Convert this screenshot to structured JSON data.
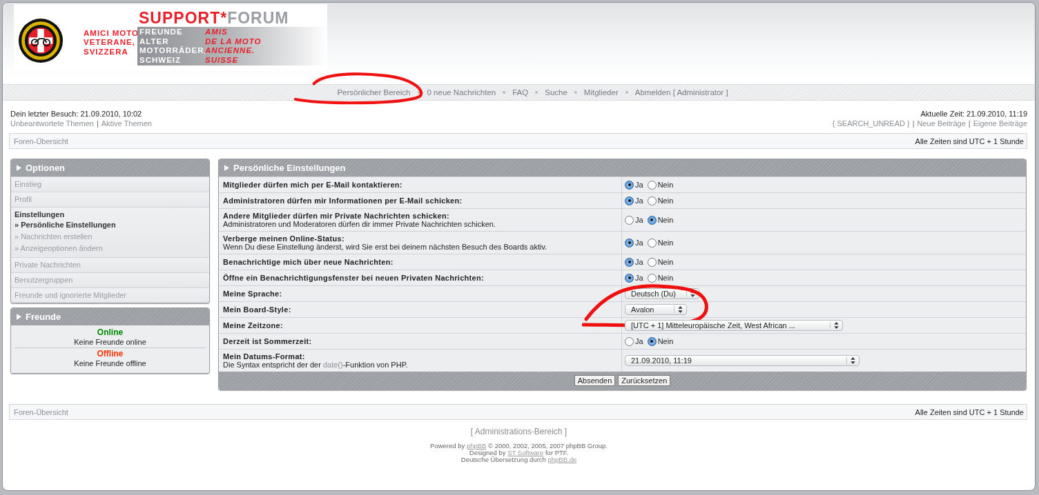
{
  "banner": {
    "title_main": "SUPPORT*",
    "title_tail": "FORUM",
    "italian": [
      "AMICI MOTO",
      "VETERANE,",
      "SVIZZERA"
    ],
    "german": [
      "FREUNDE",
      "ALTER",
      "MOTORRÄDER,",
      "SCHWEIZ"
    ],
    "french": [
      "AMIS",
      "DE LA MOTO",
      "ANCIENNE.",
      "SUISSE"
    ]
  },
  "nav": [
    "Persönlicher Bereich",
    "0 neue Nachrichten",
    "FAQ",
    "Suche",
    "Mitglieder",
    "Abmelden [ Administrator ]"
  ],
  "last_visit": "Dein letzter Besuch: 21.09.2010, 10:02",
  "left_links": [
    {
      "kind": "link",
      "text": "Unbeantwortete Themen"
    },
    {
      "kind": "separator",
      "text": "|"
    },
    {
      "kind": "link",
      "text": "Aktive Themen"
    }
  ],
  "current_time": "Aktuelle Zeit: 21.09.2010, 11:19",
  "right_links": [
    {
      "kind": "link",
      "text": "{ SEARCH_UNREAD }"
    },
    {
      "kind": "separator",
      "text": "|"
    },
    {
      "kind": "link",
      "text": "Neue Beiträge"
    },
    {
      "kind": "separator",
      "text": "|"
    },
    {
      "kind": "link",
      "text": "Eigene Beiträge"
    }
  ],
  "breadcrumb": {
    "link": "Foren-Übersicht",
    "timezone": "Alle Zeiten sind UTC + 1 Stunde"
  },
  "options_panel": {
    "title": "Optionen",
    "items": [
      {
        "label": "Einstieg",
        "selected": false
      },
      {
        "label": "Profil",
        "selected": false
      },
      {
        "label": "Einstellungen",
        "selected": true,
        "children": [
          {
            "label": "» Persönliche Einstellungen",
            "selected": true
          },
          {
            "label": "» Nachrichten erstellen",
            "selected": false
          },
          {
            "label": "» Anzeigeoptionen ändern",
            "selected": false
          }
        ]
      },
      {
        "label": "Private Nachrichten",
        "selected": false
      },
      {
        "label": "Benutzergruppen",
        "selected": false
      },
      {
        "label": "Freunde und ignorierte Mitglieder",
        "selected": false
      }
    ]
  },
  "friends_panel": {
    "title": "Freunde",
    "groups": [
      {
        "status": "Online",
        "color": "#008a00",
        "text": "Keine Freunde online"
      },
      {
        "status": "Offline",
        "color": "#ff3300",
        "text": "Keine Freunde offline"
      }
    ]
  },
  "settings": {
    "title": "Persönliche Einstellungen",
    "rows": [
      {
        "kind": "radio",
        "label": "Mitglieder dürfen mich per E-Mail kontaktieren:",
        "options": [
          {
            "label": "Ja",
            "selected": true
          },
          {
            "label": "Nein",
            "selected": false
          }
        ]
      },
      {
        "kind": "radio",
        "label": "Administratoren dürfen mir Informationen per E-Mail schicken:",
        "options": [
          {
            "label": "Ja",
            "selected": true
          },
          {
            "label": "Nein",
            "selected": false
          }
        ]
      },
      {
        "kind": "radio",
        "label": "Andere Mitglieder dürfen mir Private Nachrichten schicken:",
        "hint": "Administratoren und Moderatoren dürfen dir immer Private Nachrichten schicken.",
        "options": [
          {
            "label": "Ja",
            "selected": false
          },
          {
            "label": "Nein",
            "selected": true
          }
        ]
      },
      {
        "kind": "radio",
        "label": "Verberge meinen Online-Status:",
        "hint": "Wenn Du diese Einstellung änderst, wird Sie erst bei deinem nächsten Besuch des Boards aktiv.",
        "options": [
          {
            "label": "Ja",
            "selected": true
          },
          {
            "label": "Nein",
            "selected": false
          }
        ]
      },
      {
        "kind": "radio",
        "label": "Benachrichtige mich über neue Nachrichten:",
        "options": [
          {
            "label": "Ja",
            "selected": true
          },
          {
            "label": "Nein",
            "selected": false
          }
        ]
      },
      {
        "kind": "radio",
        "label": "Öffne ein Benachrichtigungsfenster bei neuen Privaten Nachrichten:",
        "options": [
          {
            "label": "Ja",
            "selected": true
          },
          {
            "label": "Nein",
            "selected": false
          }
        ]
      },
      {
        "kind": "select",
        "label": "Meine Sprache:",
        "value": "Deutsch (Du)"
      },
      {
        "kind": "select",
        "label": "Mein Board-Style:",
        "value": "Avalon"
      },
      {
        "kind": "select",
        "label": "Meine Zeitzone:",
        "value": "[UTC + 1] Mitteleuropäische Zeit, West African ..."
      },
      {
        "kind": "radio",
        "label": "Derzeit ist Sommerzeit:",
        "options": [
          {
            "label": "Ja",
            "selected": false
          },
          {
            "label": "Nein",
            "selected": true
          }
        ]
      },
      {
        "kind": "select",
        "label": "Mein Datums-Format:",
        "hint": "Die Syntax entspricht der der ",
        "hint_link": "date()",
        "hint_after": "-Funktion von PHP.",
        "value": "21.09.2010, 11:19"
      }
    ],
    "buttons": [
      "Absenden",
      "Zurücksetzen"
    ]
  },
  "footer_breadcrumb": {
    "link": "Foren-Übersicht",
    "timezone": "Alle Zeiten sind UTC + 1 Stunde"
  },
  "admin_link": "[ Administrations-Bereich ]",
  "credits": [
    {
      "before": "Powered by ",
      "link": "phpBB",
      "after": " © 2000, 2002, 2005, 2007 phpBB Group."
    },
    {
      "before": "Designed by ",
      "link": "ST Software",
      "after": " for PTF."
    },
    {
      "before": "Deutsche Übersetzung durch ",
      "link": "phpBB.de"
    }
  ],
  "annotations": [
    {
      "kind": "freehand-loop"
    },
    {
      "kind": "freehand-loop"
    }
  ]
}
